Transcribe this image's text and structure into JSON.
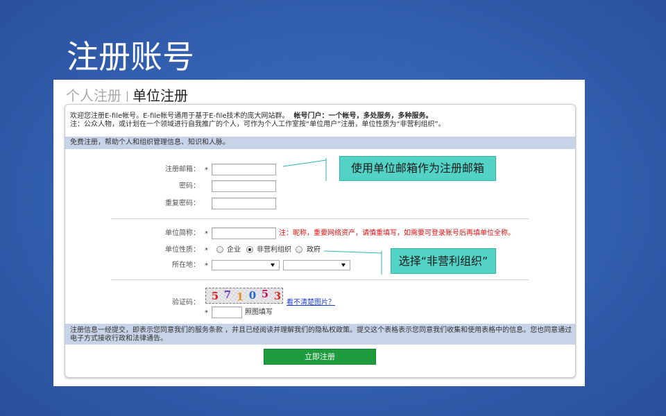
{
  "slide": {
    "title": "注册账号"
  },
  "tabs": {
    "personal": "个人注册",
    "separator": "|",
    "organization": "单位注册"
  },
  "intro": {
    "line1": "欢迎您注册E-file帐号。E-file帐号通用于基于E-file技术的庞大网站群。",
    "line1_bold": "帐号门户：一个帐号，多处服务，多种服务。",
    "line2": "注：公众人物，或计划在一个领域进行自我推广的个人，可作为个人工作室按“单位用户”注册，单位性质为“非营利组织”。"
  },
  "banner": "免费注册，帮助个人和组织管理信息、知识和人脉。",
  "form": {
    "required_mark": "*",
    "email": {
      "label": "注册邮箱：",
      "value": ""
    },
    "password": {
      "label": "密码：",
      "value": ""
    },
    "password_confirm": {
      "label": "重复密码：",
      "value": ""
    },
    "org_short_name": {
      "label": "单位简称：",
      "value": "",
      "note": "注：昵称，重要网络资产，请慎重填写，如需要可登录账号后再填单位全称。"
    },
    "org_type": {
      "label": "单位性质：",
      "options": [
        {
          "label": "企业",
          "checked": false
        },
        {
          "label": "非营利组织",
          "checked": true
        },
        {
          "label": "政府",
          "checked": false
        }
      ]
    },
    "location": {
      "label": "所在地：",
      "province": "",
      "city": ""
    },
    "captcha": {
      "label": "验证码：",
      "image_text": "571053",
      "refresh_link": "看不清楚图片？",
      "value": "",
      "hint": "照图填写"
    }
  },
  "terms": "注册信息一经提交，即表示您同意我们的服务条款 ，并且已经阅读并理解我们的隐私权政策。提交这个表格表示您同意我们收集和使用表格中的信息。您也同意通过电子方式接收行政和法律通告。",
  "submit_label": "立即注册",
  "callouts": {
    "email_tip": "使用单位邮箱作为注册邮箱",
    "org_type_tip": "选择“非营利组织”"
  },
  "colors": {
    "submit_button": "#1d9b3d",
    "callout_fill": "#52d3c6",
    "note_red": "#e01010",
    "link_blue": "#1d3fd1",
    "info_bar": "#c7d4e8"
  }
}
